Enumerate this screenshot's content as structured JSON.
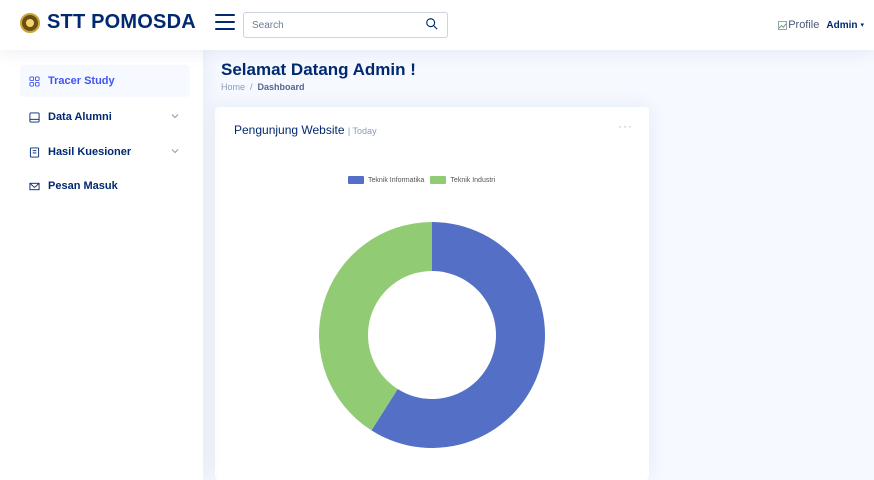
{
  "header": {
    "brand": "STT POMOSDA",
    "search_placeholder": "Search",
    "profile_image_alt": "Profile",
    "profile_name": "Admin",
    "caret": "▾"
  },
  "sidebar": {
    "items": [
      {
        "label": "Tracer Study",
        "icon": "grid-icon",
        "active": true
      },
      {
        "label": "Data Alumni",
        "icon": "database-icon",
        "has_children": true
      },
      {
        "label": "Hasil Kuesioner",
        "icon": "document-icon",
        "has_children": true
      },
      {
        "label": "Pesan Masuk",
        "icon": "envelope-icon"
      }
    ]
  },
  "main": {
    "title": "Selamat Datang Admin !",
    "breadcrumb": {
      "home": "Home",
      "separator": "/",
      "current": "Dashboard"
    }
  },
  "card": {
    "title": "Pengunjung Website",
    "subtitle": "| Today",
    "menu": "···"
  },
  "chart_data": {
    "type": "pie",
    "variant": "doughnut",
    "legend_position": "top",
    "categories": [
      "Teknik Informatika",
      "Teknik Industri"
    ],
    "values": [
      59,
      41
    ],
    "colors": [
      "#5470c6",
      "#91cc75"
    ]
  },
  "colors": {
    "brand": "#012970",
    "accent": "#4154f1",
    "background": "#f6f9ff"
  }
}
